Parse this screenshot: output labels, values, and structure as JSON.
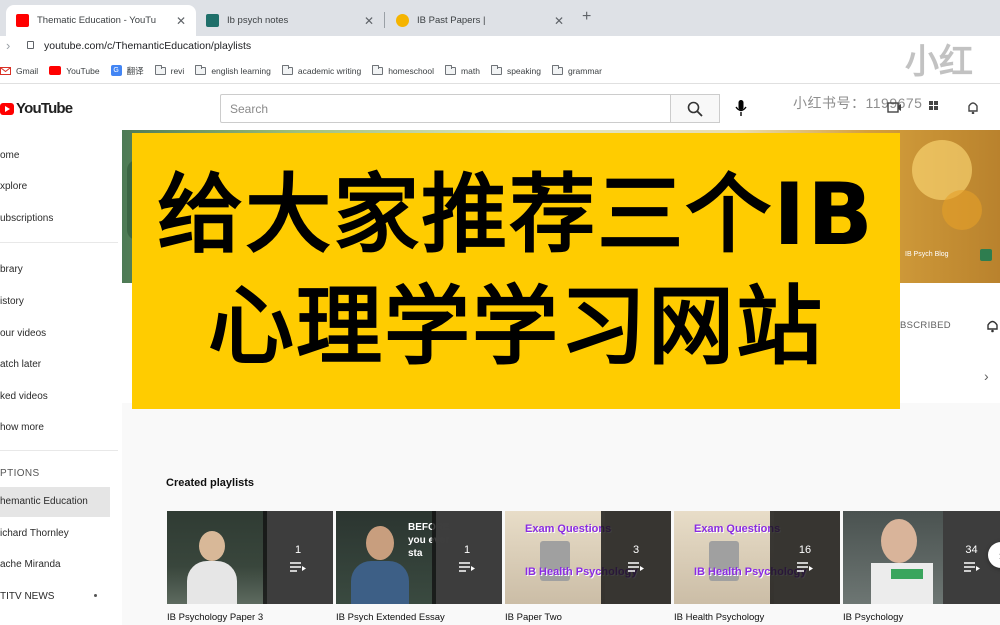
{
  "tabs": [
    {
      "title": "Thematic Education - YouTu",
      "favicon_color": "#ff0000",
      "active": true
    },
    {
      "title": "Ib psych notes",
      "favicon_color": "#1f6f6a",
      "active": false
    },
    {
      "title": "IB Past Papers |",
      "favicon_color": "#f5b400",
      "active": false
    }
  ],
  "address_bar": {
    "url": "youtube.com/c/ThemanticEducation/playlists"
  },
  "bookmarks": [
    {
      "label": "Gmail",
      "icon": "gmail-icon"
    },
    {
      "label": "YouTube",
      "icon": "youtube-icon"
    },
    {
      "label": "翻译",
      "icon": "translate-icon"
    },
    {
      "label": "revi",
      "icon": "folder-icon"
    },
    {
      "label": "english learning",
      "icon": "folder-icon"
    },
    {
      "label": "academic writing",
      "icon": "folder-icon"
    },
    {
      "label": "homeschool",
      "icon": "folder-icon"
    },
    {
      "label": "math",
      "icon": "folder-icon"
    },
    {
      "label": "speaking",
      "icon": "folder-icon"
    },
    {
      "label": "grammar",
      "icon": "folder-icon"
    }
  ],
  "youtube": {
    "logo_text": "YouTube",
    "search_placeholder": "Search"
  },
  "watermark": {
    "text": "小红书号：1199675",
    "logo": "小红"
  },
  "sidebar": {
    "items": [
      {
        "label": "ome"
      },
      {
        "label": "xplore"
      },
      {
        "label": "ubscriptions"
      },
      {
        "label": "brary"
      },
      {
        "label": "istory"
      },
      {
        "label": "our videos"
      },
      {
        "label": "atch later"
      },
      {
        "label": "ked videos"
      },
      {
        "label": "how more"
      }
    ],
    "section_title": "PTIONS",
    "subscriptions": [
      {
        "label": "hemantic Education"
      },
      {
        "label": "ichard Thornley"
      },
      {
        "label": "ache Miranda"
      },
      {
        "label": "TITV NEWS"
      }
    ]
  },
  "channel": {
    "banner_label": "IB Psych Blog",
    "subscribed_label": "BSCRIBED"
  },
  "section_title": "Created playlists",
  "playlists": [
    {
      "title": "IB Psychology Paper 3",
      "count": "1"
    },
    {
      "title": "IB Psych Extended Essay",
      "count": "1"
    },
    {
      "title": "IB Paper Two",
      "count": "3"
    },
    {
      "title": "IB Health Psychology",
      "count": "16"
    },
    {
      "title": "IB Psychology",
      "count": "34"
    }
  ],
  "thumb_text": {
    "exam": "Exam Questions",
    "health": "IB Health Psychology",
    "before": "BEFORE",
    "you": "you ever",
    "sta": "sta"
  },
  "caption": {
    "line1": "给大家推荐三个IB",
    "line2": "心理学学习网站",
    "background": "#ffcc00"
  }
}
